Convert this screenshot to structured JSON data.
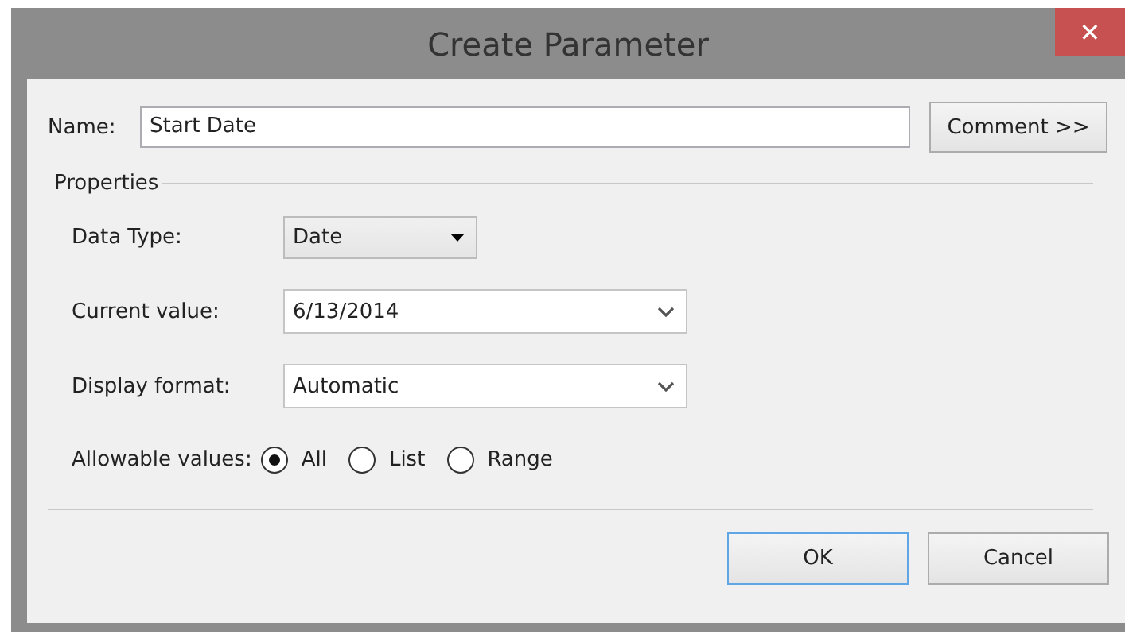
{
  "window": {
    "title": "Create Parameter",
    "close": "✕"
  },
  "name_field": {
    "label": "Name:",
    "value": "Start Date"
  },
  "comment_button": "Comment >>",
  "properties": {
    "title": "Properties",
    "data_type": {
      "label": "Data Type:",
      "value": "Date"
    },
    "current_value": {
      "label": "Current value:",
      "value": "6/13/2014"
    },
    "display_format": {
      "label": "Display format:",
      "value": "Automatic"
    },
    "allowable_values": {
      "label": "Allowable values:",
      "options": [
        {
          "label": "All",
          "selected": true
        },
        {
          "label": "List",
          "selected": false
        },
        {
          "label": "Range",
          "selected": false
        }
      ]
    }
  },
  "buttons": [
    {
      "label": "OK",
      "default": true
    },
    {
      "label": "Cancel",
      "default": false
    }
  ]
}
